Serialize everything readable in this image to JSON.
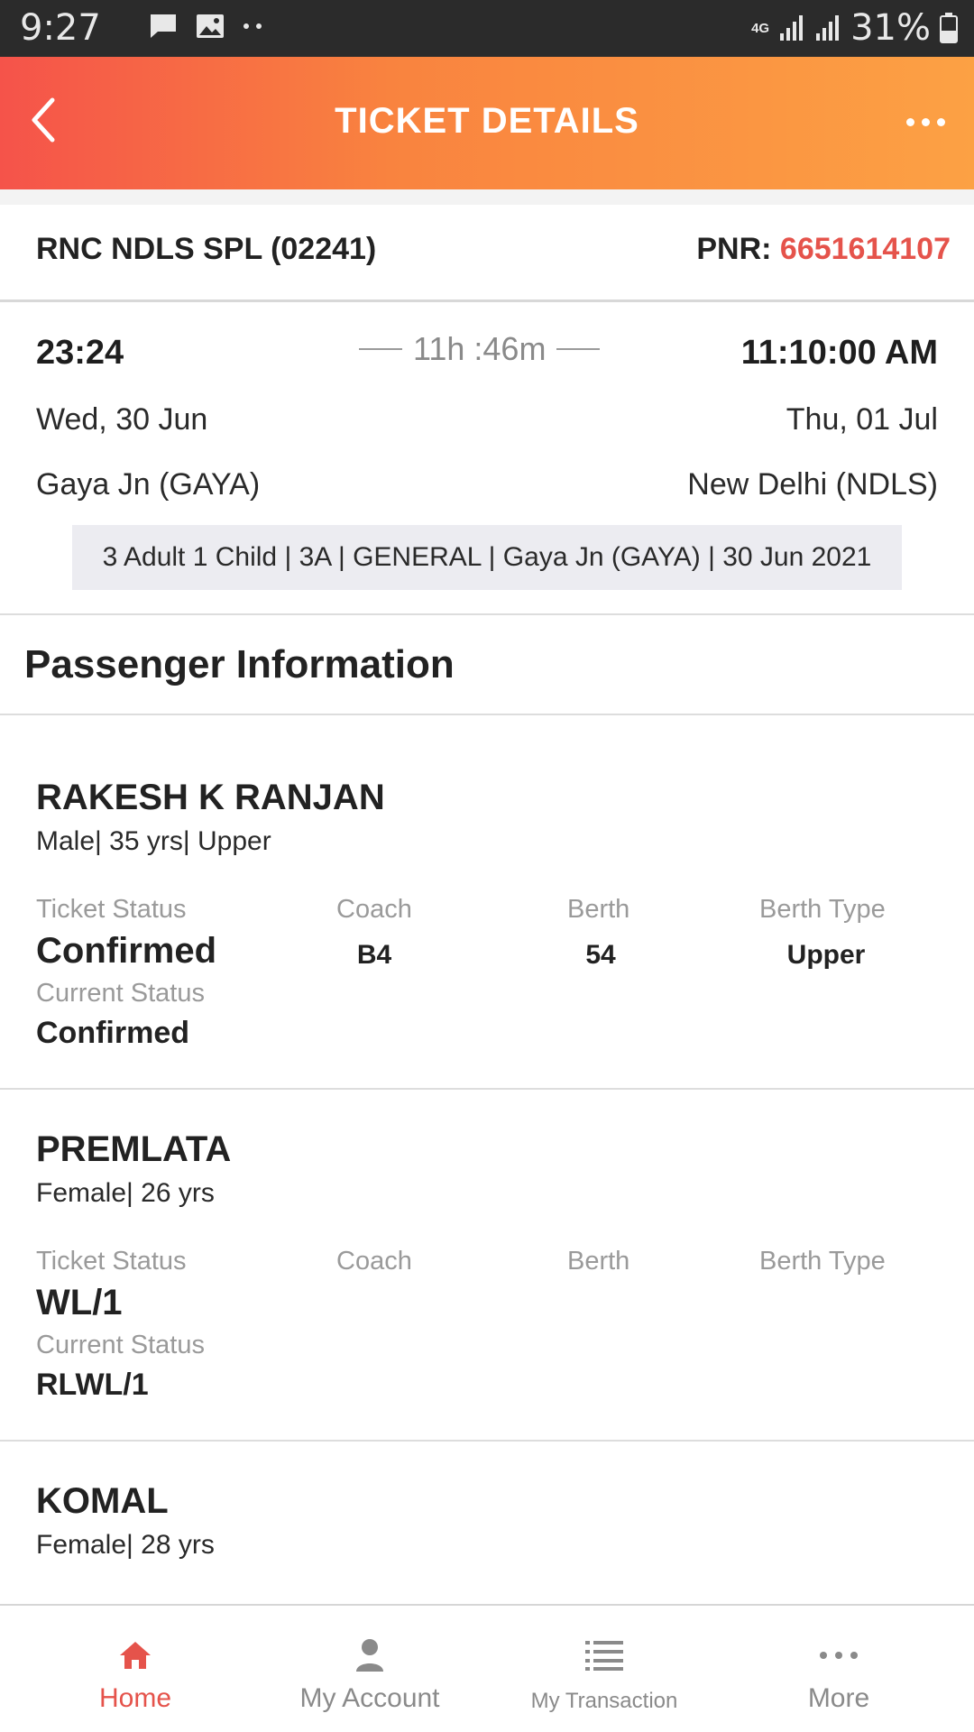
{
  "status_bar": {
    "time": "9:27",
    "network": "4G",
    "battery": "31%"
  },
  "header": {
    "title": "TICKET DETAILS"
  },
  "train": {
    "name": "RNC NDLS SPL (02241)",
    "pnr_label": "PNR:",
    "pnr": "6651614107"
  },
  "journey": {
    "departure_time": "23:24",
    "duration": "11h :46m",
    "arrival_time": "11:10:00 AM",
    "departure_date": "Wed, 30 Jun",
    "arrival_date": "Thu, 01 Jul",
    "from_station": "Gaya Jn (GAYA)",
    "to_station": "New Delhi (NDLS)",
    "summary": "3 Adult 1 Child | 3A | GENERAL | Gaya Jn (GAYA) | 30 Jun 2021"
  },
  "passengers_section": {
    "title": "Passenger Information",
    "labels": {
      "ticket_status": "Ticket Status",
      "coach": "Coach",
      "berth": "Berth",
      "berth_type": "Berth Type",
      "current_status": "Current Status"
    },
    "passengers": [
      {
        "name": "RAKESH K RANJAN",
        "meta": "Male| 35 yrs| Upper",
        "ticket_status": "Confirmed",
        "coach": "B4",
        "berth": "54",
        "berth_type": "Upper",
        "current_status": "Confirmed"
      },
      {
        "name": "PREMLATA",
        "meta": "Female| 26 yrs",
        "ticket_status": "WL/1",
        "coach": "",
        "berth": "",
        "berth_type": "",
        "current_status": "RLWL/1"
      },
      {
        "name": "KOMAL",
        "meta": "Female| 28 yrs"
      }
    ]
  },
  "bottom_nav": {
    "items": [
      {
        "label": "Home",
        "icon": "home-icon",
        "active": true
      },
      {
        "label": "My Account",
        "icon": "person-icon"
      },
      {
        "label": "My Transaction",
        "icon": "list-icon"
      },
      {
        "label": "More",
        "icon": "more-dots-icon"
      }
    ]
  },
  "colors": {
    "accent": "#e5534b",
    "header_start": "#f5534a",
    "header_end": "#fca144"
  }
}
